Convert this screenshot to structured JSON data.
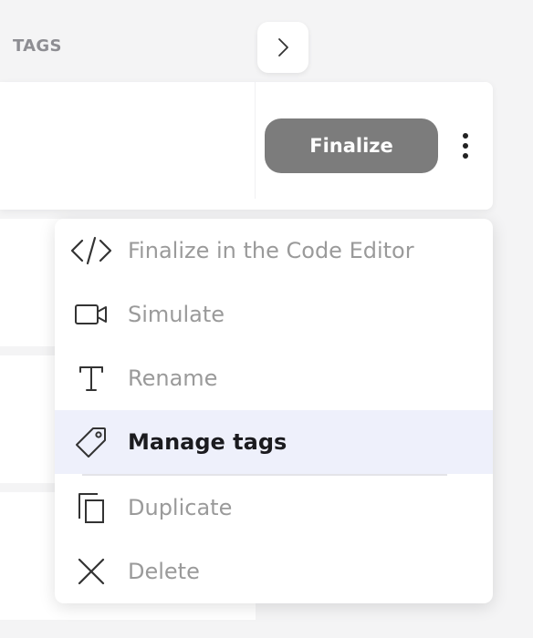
{
  "header": {
    "tags_label": "TAGS"
  },
  "nav": {
    "arrow_icon": "chevron-right-icon"
  },
  "row": {
    "finalize_label": "Finalize",
    "more_icon": "kebab-menu-icon"
  },
  "menu": {
    "items": [
      {
        "label": "Finalize in the Code Editor",
        "icon": "code-icon",
        "active": false
      },
      {
        "label": "Simulate",
        "icon": "video-camera-icon",
        "active": false
      },
      {
        "label": "Rename",
        "icon": "text-icon",
        "active": false
      },
      {
        "label": "Manage tags",
        "icon": "tag-icon",
        "active": true
      },
      {
        "label": "Duplicate",
        "icon": "copy-icon",
        "active": false
      },
      {
        "label": "Delete",
        "icon": "close-icon",
        "active": false
      }
    ]
  },
  "colors": {
    "background": "#f4f4f5",
    "button_gray": "#7c7c7c",
    "active_item_bg": "#eef0fb",
    "muted_text": "#9a9a9a",
    "active_text": "#1b1b1f"
  }
}
